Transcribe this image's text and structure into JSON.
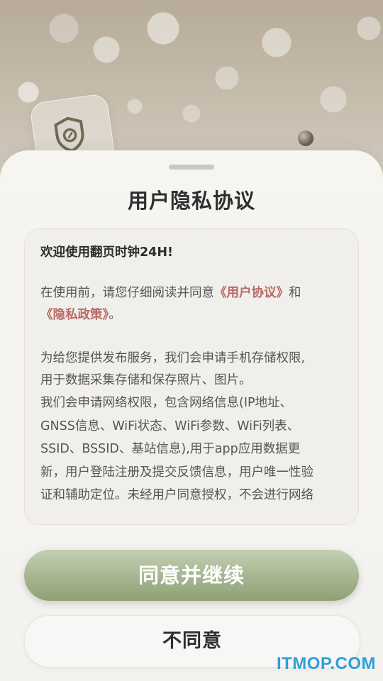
{
  "dialog": {
    "title": "用户隐私协议",
    "welcome": "欢迎使用翻页时钟24H!",
    "intro_prefix": "在使用前，请您仔细阅读并同意",
    "user_agreement_link": "《用户协议》",
    "intro_and": "和",
    "privacy_policy_link": "《隐私政策》",
    "intro_suffix": "。",
    "storage_line1": "为给您提供发布服务，我们会申请手机存储权限,",
    "storage_line2": "用于数据采集存储和保存照片、图片。",
    "network_line1": "我们会申请网络权限，包含网络信息(IP地址、",
    "network_line2": "GNSS信息、WiFi状态、WiFi参数、WiFi列表、",
    "network_line3": "SSID、BSSID、基站信息),用于app应用数据更",
    "network_line4": "新，用户登陆注册及提交反馈信息，用户唯一性验",
    "network_line5": "证和辅助定位。未经用户同意授权，不会进行网络"
  },
  "buttons": {
    "agree": "同意并继续",
    "disagree": "不同意"
  },
  "watermark": "ITMOP.COM",
  "colors": {
    "accent_green": "#9aab80",
    "link_red": "#b86a63",
    "watermark_blue": "#2f9fd8"
  },
  "icons": {
    "background_badge": "shield-icon"
  }
}
